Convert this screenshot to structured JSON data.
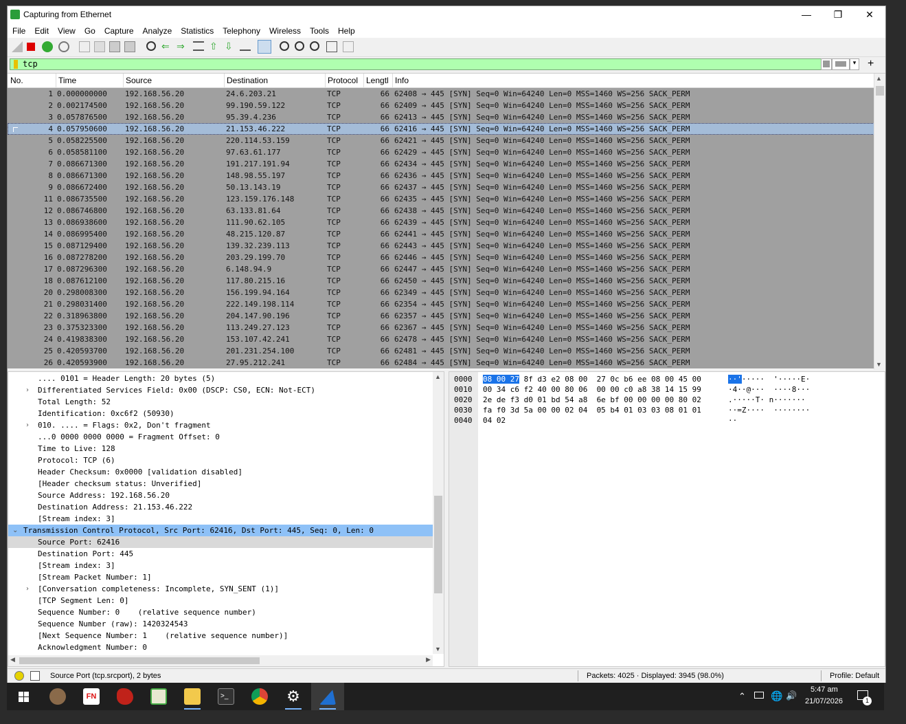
{
  "window": {
    "title": "Capturing from Ethernet"
  },
  "menu": [
    "File",
    "Edit",
    "View",
    "Go",
    "Capture",
    "Analyze",
    "Statistics",
    "Telephony",
    "Wireless",
    "Tools",
    "Help"
  ],
  "filter": {
    "value": "tcp"
  },
  "columns": {
    "no": "No.",
    "time": "Time",
    "source": "Source",
    "destination": "Destination",
    "protocol": "Protocol",
    "length": "Lengtl",
    "info": "Info"
  },
  "packets": [
    {
      "no": "1",
      "time": "0.000000000",
      "src": "192.168.56.20",
      "dst": "24.6.203.21",
      "proto": "TCP",
      "len": "66",
      "info": "62408 → 445 [SYN] Seq=0 Win=64240 Len=0 MSS=1460 WS=256 SACK_PERM"
    },
    {
      "no": "2",
      "time": "0.002174500",
      "src": "192.168.56.20",
      "dst": "99.190.59.122",
      "proto": "TCP",
      "len": "66",
      "info": "62409 → 445 [SYN] Seq=0 Win=64240 Len=0 MSS=1460 WS=256 SACK_PERM"
    },
    {
      "no": "3",
      "time": "0.057876500",
      "src": "192.168.56.20",
      "dst": "95.39.4.236",
      "proto": "TCP",
      "len": "66",
      "info": "62413 → 445 [SYN] Seq=0 Win=64240 Len=0 MSS=1460 WS=256 SACK_PERM"
    },
    {
      "no": "4",
      "time": "0.057950600",
      "src": "192.168.56.20",
      "dst": "21.153.46.222",
      "proto": "TCP",
      "len": "66",
      "info": "62416 → 445 [SYN] Seq=0 Win=64240 Len=0 MSS=1460 WS=256 SACK_PERM",
      "selected": true
    },
    {
      "no": "5",
      "time": "0.058225500",
      "src": "192.168.56.20",
      "dst": "220.114.53.159",
      "proto": "TCP",
      "len": "66",
      "info": "62421 → 445 [SYN] Seq=0 Win=64240 Len=0 MSS=1460 WS=256 SACK_PERM"
    },
    {
      "no": "6",
      "time": "0.058581100",
      "src": "192.168.56.20",
      "dst": "97.63.61.177",
      "proto": "TCP",
      "len": "66",
      "info": "62429 → 445 [SYN] Seq=0 Win=64240 Len=0 MSS=1460 WS=256 SACK_PERM"
    },
    {
      "no": "7",
      "time": "0.086671300",
      "src": "192.168.56.20",
      "dst": "191.217.191.94",
      "proto": "TCP",
      "len": "66",
      "info": "62434 → 445 [SYN] Seq=0 Win=64240 Len=0 MSS=1460 WS=256 SACK_PERM"
    },
    {
      "no": "8",
      "time": "0.086671300",
      "src": "192.168.56.20",
      "dst": "148.98.55.197",
      "proto": "TCP",
      "len": "66",
      "info": "62436 → 445 [SYN] Seq=0 Win=64240 Len=0 MSS=1460 WS=256 SACK_PERM"
    },
    {
      "no": "9",
      "time": "0.086672400",
      "src": "192.168.56.20",
      "dst": "50.13.143.19",
      "proto": "TCP",
      "len": "66",
      "info": "62437 → 445 [SYN] Seq=0 Win=64240 Len=0 MSS=1460 WS=256 SACK_PERM"
    },
    {
      "no": "11",
      "time": "0.086735500",
      "src": "192.168.56.20",
      "dst": "123.159.176.148",
      "proto": "TCP",
      "len": "66",
      "info": "62435 → 445 [SYN] Seq=0 Win=64240 Len=0 MSS=1460 WS=256 SACK_PERM"
    },
    {
      "no": "12",
      "time": "0.086746800",
      "src": "192.168.56.20",
      "dst": "63.133.81.64",
      "proto": "TCP",
      "len": "66",
      "info": "62438 → 445 [SYN] Seq=0 Win=64240 Len=0 MSS=1460 WS=256 SACK_PERM"
    },
    {
      "no": "13",
      "time": "0.086938600",
      "src": "192.168.56.20",
      "dst": "111.90.62.105",
      "proto": "TCP",
      "len": "66",
      "info": "62439 → 445 [SYN] Seq=0 Win=64240 Len=0 MSS=1460 WS=256 SACK_PERM"
    },
    {
      "no": "14",
      "time": "0.086995400",
      "src": "192.168.56.20",
      "dst": "48.215.120.87",
      "proto": "TCP",
      "len": "66",
      "info": "62441 → 445 [SYN] Seq=0 Win=64240 Len=0 MSS=1460 WS=256 SACK_PERM"
    },
    {
      "no": "15",
      "time": "0.087129400",
      "src": "192.168.56.20",
      "dst": "139.32.239.113",
      "proto": "TCP",
      "len": "66",
      "info": "62443 → 445 [SYN] Seq=0 Win=64240 Len=0 MSS=1460 WS=256 SACK_PERM"
    },
    {
      "no": "16",
      "time": "0.087278200",
      "src": "192.168.56.20",
      "dst": "203.29.199.70",
      "proto": "TCP",
      "len": "66",
      "info": "62446 → 445 [SYN] Seq=0 Win=64240 Len=0 MSS=1460 WS=256 SACK_PERM"
    },
    {
      "no": "17",
      "time": "0.087296300",
      "src": "192.168.56.20",
      "dst": "6.148.94.9",
      "proto": "TCP",
      "len": "66",
      "info": "62447 → 445 [SYN] Seq=0 Win=64240 Len=0 MSS=1460 WS=256 SACK_PERM"
    },
    {
      "no": "18",
      "time": "0.087612100",
      "src": "192.168.56.20",
      "dst": "117.80.215.16",
      "proto": "TCP",
      "len": "66",
      "info": "62450 → 445 [SYN] Seq=0 Win=64240 Len=0 MSS=1460 WS=256 SACK_PERM"
    },
    {
      "no": "20",
      "time": "0.298008300",
      "src": "192.168.56.20",
      "dst": "156.199.94.164",
      "proto": "TCP",
      "len": "66",
      "info": "62349 → 445 [SYN] Seq=0 Win=64240 Len=0 MSS=1460 WS=256 SACK_PERM"
    },
    {
      "no": "21",
      "time": "0.298031400",
      "src": "192.168.56.20",
      "dst": "222.149.198.114",
      "proto": "TCP",
      "len": "66",
      "info": "62354 → 445 [SYN] Seq=0 Win=64240 Len=0 MSS=1460 WS=256 SACK_PERM"
    },
    {
      "no": "22",
      "time": "0.318963800",
      "src": "192.168.56.20",
      "dst": "204.147.90.196",
      "proto": "TCP",
      "len": "66",
      "info": "62357 → 445 [SYN] Seq=0 Win=64240 Len=0 MSS=1460 WS=256 SACK_PERM"
    },
    {
      "no": "23",
      "time": "0.375323300",
      "src": "192.168.56.20",
      "dst": "113.249.27.123",
      "proto": "TCP",
      "len": "66",
      "info": "62367 → 445 [SYN] Seq=0 Win=64240 Len=0 MSS=1460 WS=256 SACK_PERM"
    },
    {
      "no": "24",
      "time": "0.419838300",
      "src": "192.168.56.20",
      "dst": "153.107.42.241",
      "proto": "TCP",
      "len": "66",
      "info": "62478 → 445 [SYN] Seq=0 Win=64240 Len=0 MSS=1460 WS=256 SACK_PERM"
    },
    {
      "no": "25",
      "time": "0.420593700",
      "src": "192.168.56.20",
      "dst": "201.231.254.100",
      "proto": "TCP",
      "len": "66",
      "info": "62481 → 445 [SYN] Seq=0 Win=64240 Len=0 MSS=1460 WS=256 SACK_PERM"
    },
    {
      "no": "26",
      "time": "0.420593900",
      "src": "192.168.56.20",
      "dst": "27.95.212.241",
      "proto": "TCP",
      "len": "66",
      "info": "62484 → 445 [SYN] Seq=0 Win=64240 Len=0 MSS=1460 WS=256 SACK_PERM"
    }
  ],
  "details": [
    {
      "text": ".... 0101 = Header Length: 20 bytes (5)",
      "indent": 2
    },
    {
      "text": "Differentiated Services Field: 0x00 (DSCP: CS0, ECN: Not-ECT)",
      "indent": 2,
      "arrow": "›"
    },
    {
      "text": "Total Length: 52",
      "indent": 2
    },
    {
      "text": "Identification: 0xc6f2 (50930)",
      "indent": 2
    },
    {
      "text": "010. .... = Flags: 0x2, Don't fragment",
      "indent": 2,
      "arrow": "›"
    },
    {
      "text": "...0 0000 0000 0000 = Fragment Offset: 0",
      "indent": 2
    },
    {
      "text": "Time to Live: 128",
      "indent": 2
    },
    {
      "text": "Protocol: TCP (6)",
      "indent": 2
    },
    {
      "text": "Header Checksum: 0x0000 [validation disabled]",
      "indent": 2
    },
    {
      "text": "[Header checksum status: Unverified]",
      "indent": 2
    },
    {
      "text": "Source Address: 192.168.56.20",
      "indent": 2
    },
    {
      "text": "Destination Address: 21.153.46.222",
      "indent": 2
    },
    {
      "text": "[Stream index: 3]",
      "indent": 2
    },
    {
      "text": "Transmission Control Protocol, Src Port: 62416, Dst Port: 445, Seq: 0, Len: 0",
      "indent": 1,
      "arrow": "⌄",
      "highlight": "hl"
    },
    {
      "text": "Source Port: 62416",
      "indent": 2,
      "highlight": "hl2"
    },
    {
      "text": "Destination Port: 445",
      "indent": 2
    },
    {
      "text": "[Stream index: 3]",
      "indent": 2
    },
    {
      "text": "[Stream Packet Number: 1]",
      "indent": 2
    },
    {
      "text": "[Conversation completeness: Incomplete, SYN_SENT (1)]",
      "indent": 2,
      "arrow": "›"
    },
    {
      "text": "[TCP Segment Len: 0]",
      "indent": 2
    },
    {
      "text": "Sequence Number: 0    (relative sequence number)",
      "indent": 2
    },
    {
      "text": "Sequence Number (raw): 1420324543",
      "indent": 2
    },
    {
      "text": "[Next Sequence Number: 1    (relative sequence number)]",
      "indent": 2
    },
    {
      "text": "Acknowledgment Number: 0",
      "indent": 2
    }
  ],
  "hex": [
    {
      "off": "0000",
      "sel": "08 00 27",
      "rest": " 8f d3 e2 08 00  27 0c b6 ee 08 00 45 00",
      "asel": "··'",
      "arest": "·····  '·····E·"
    },
    {
      "off": "0010",
      "sel": "",
      "rest": "00 34 c6 f2 40 00 80 06  00 00 c0 a8 38 14 15 99",
      "asel": "",
      "arest": "·4··@···  ····8···"
    },
    {
      "off": "0020",
      "sel": "",
      "rest": "2e de f3 d0 01 bd 54 a8  6e bf 00 00 00 00 80 02",
      "asel": "",
      "arest": ".·····T· n·······"
    },
    {
      "off": "0030",
      "sel": "",
      "rest": "fa f0 3d 5a 00 00 02 04  05 b4 01 03 03 08 01 01",
      "asel": "",
      "arest": "··=Z····  ········"
    },
    {
      "off": "0040",
      "sel": "",
      "rest": "04 02",
      "asel": "",
      "arest": "··"
    }
  ],
  "status": {
    "field": "Source Port (tcp.srcport), 2 bytes",
    "packets": "Packets: 4025 · Displayed: 3945 (98.0%)",
    "profile": "Profile: Default"
  },
  "taskbar": {
    "time": "5:47 am",
    "date": "21/07/2026",
    "notifications": "1"
  }
}
